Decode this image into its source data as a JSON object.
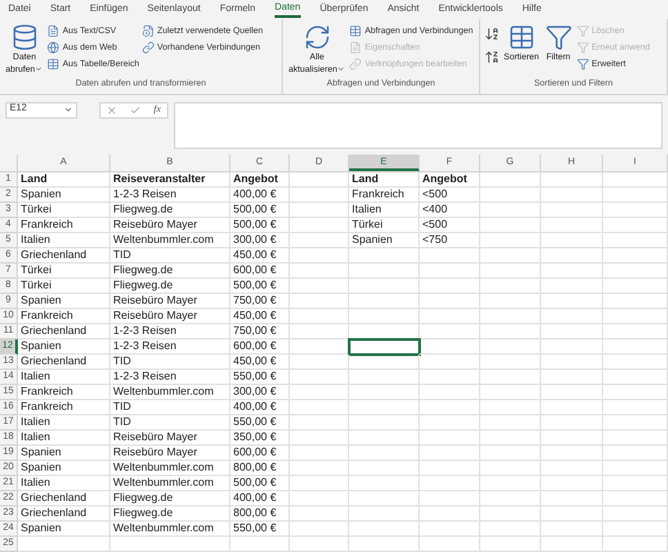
{
  "ribbon_tabs": [
    {
      "label": "Datei",
      "selected": false
    },
    {
      "label": "Start",
      "selected": false
    },
    {
      "label": "Einfügen",
      "selected": false
    },
    {
      "label": "Seitenlayout",
      "selected": false
    },
    {
      "label": "Formeln",
      "selected": false
    },
    {
      "label": "Daten",
      "selected": true
    },
    {
      "label": "Überprüfen",
      "selected": false
    },
    {
      "label": "Ansicht",
      "selected": false
    },
    {
      "label": "Entwicklertools",
      "selected": false
    },
    {
      "label": "Hilfe",
      "selected": false
    }
  ],
  "ribbon_groups": [
    {
      "label": "Daten abrufen und transformieren",
      "large": [
        {
          "lines": [
            "Daten",
            "abrufen"
          ],
          "dropdown": true
        }
      ],
      "columns": [
        [
          {
            "label": "Aus Text/CSV",
            "disabled": false
          },
          {
            "label": "Aus dem Web",
            "disabled": false
          },
          {
            "label": "Aus Tabelle/Bereich",
            "disabled": false
          }
        ],
        [
          {
            "label": "Zuletzt verwendete Quellen",
            "disabled": false
          },
          {
            "label": "Vorhandene Verbindungen",
            "disabled": false
          }
        ]
      ]
    },
    {
      "label": "Abfragen und Verbindungen",
      "large": [
        {
          "lines": [
            "Alle",
            "aktualisieren"
          ],
          "dropdown": true
        }
      ],
      "columns": [
        [
          {
            "label": "Abfragen und Verbindungen",
            "disabled": false
          },
          {
            "label": "Eigenschaften",
            "disabled": true
          },
          {
            "label": "Verknüpfungen bearbeiten",
            "disabled": true
          }
        ]
      ]
    },
    {
      "label": "Sortieren und Filtern",
      "large": [
        {
          "lines": [
            "Sortieren"
          ],
          "dropdown": false
        },
        {
          "lines": [
            "Filtern"
          ],
          "dropdown": false
        }
      ],
      "columns": [
        [
          {
            "label": "Löschen",
            "disabled": true
          },
          {
            "label": "Erneut anwend",
            "disabled": true
          },
          {
            "label": "Erweitert",
            "disabled": false
          }
        ]
      ]
    }
  ],
  "name_box": "E12",
  "formula_symbol": "fx",
  "columns": [
    {
      "letter": "A",
      "selected": false
    },
    {
      "letter": "B",
      "selected": false
    },
    {
      "letter": "C",
      "selected": false
    },
    {
      "letter": "D",
      "selected": false
    },
    {
      "letter": "E",
      "selected": true
    },
    {
      "letter": "F",
      "selected": false
    },
    {
      "letter": "G",
      "selected": false
    },
    {
      "letter": "H",
      "selected": false
    },
    {
      "letter": "I",
      "selected": false
    }
  ],
  "rows": [
    {
      "number": "1",
      "kind": "header",
      "selected": false,
      "main": [
        "Land",
        "Reiseveranstalter",
        "Angebot"
      ],
      "side": [
        "Land",
        "Angebot"
      ]
    },
    {
      "number": "2",
      "kind": "data",
      "selected": false,
      "main": [
        "Spanien",
        "1-2-3 Reisen",
        "400,00 €"
      ],
      "side": [
        "Frankreich",
        "<500"
      ]
    },
    {
      "number": "3",
      "kind": "data",
      "selected": false,
      "main": [
        "Türkei",
        "Fliegweg.de",
        "500,00 €"
      ],
      "side": [
        "Italien",
        "<400"
      ]
    },
    {
      "number": "4",
      "kind": "data",
      "selected": false,
      "main": [
        "Frankreich",
        "Reisebüro Mayer",
        "500,00 €"
      ],
      "side": [
        "Türkei",
        "<500"
      ]
    },
    {
      "number": "5",
      "kind": "data",
      "selected": false,
      "main": [
        "Italien",
        "Weltenbummler.com",
        "300,00 €"
      ],
      "side": [
        "Spanien",
        "<750"
      ]
    },
    {
      "number": "6",
      "kind": "data",
      "selected": false,
      "main": [
        "Griechenland",
        "TID",
        "450,00 €"
      ]
    },
    {
      "number": "7",
      "kind": "data",
      "selected": false,
      "main": [
        "Türkei",
        "Fliegweg.de",
        "600,00 €"
      ]
    },
    {
      "number": "8",
      "kind": "data",
      "selected": false,
      "main": [
        "Türkei",
        "Fliegweg.de",
        "500,00 €"
      ]
    },
    {
      "number": "9",
      "kind": "data",
      "selected": false,
      "main": [
        "Spanien",
        "Reisebüro Mayer",
        "750,00 €"
      ]
    },
    {
      "number": "10",
      "kind": "data",
      "selected": false,
      "main": [
        "Frankreich",
        "Reisebüro Mayer",
        "450,00 €"
      ]
    },
    {
      "number": "11",
      "kind": "data",
      "selected": false,
      "main": [
        "Griechenland",
        "1-2-3 Reisen",
        "750,00 €"
      ]
    },
    {
      "number": "12",
      "kind": "data",
      "selected": true,
      "main": [
        "Spanien",
        "1-2-3 Reisen",
        "600,00 €"
      ]
    },
    {
      "number": "13",
      "kind": "data",
      "selected": false,
      "main": [
        "Griechenland",
        "TID",
        "450,00 €"
      ]
    },
    {
      "number": "14",
      "kind": "data",
      "selected": false,
      "main": [
        "Italien",
        "1-2-3 Reisen",
        "550,00 €"
      ]
    },
    {
      "number": "15",
      "kind": "data",
      "selected": false,
      "main": [
        "Frankreich",
        "Weltenbummler.com",
        "300,00 €"
      ]
    },
    {
      "number": "16",
      "kind": "data",
      "selected": false,
      "main": [
        "Frankreich",
        "TID",
        "400,00 €"
      ]
    },
    {
      "number": "17",
      "kind": "data",
      "selected": false,
      "main": [
        "Italien",
        "TID",
        "550,00 €"
      ]
    },
    {
      "number": "18",
      "kind": "data",
      "selected": false,
      "main": [
        "Italien",
        "Reisebüro Mayer",
        "350,00 €"
      ]
    },
    {
      "number": "19",
      "kind": "data",
      "selected": false,
      "main": [
        "Spanien",
        "Reisebüro Mayer",
        "600,00 €"
      ]
    },
    {
      "number": "20",
      "kind": "data",
      "selected": false,
      "main": [
        "Spanien",
        "Weltenbummler.com",
        "800,00 €"
      ]
    },
    {
      "number": "21",
      "kind": "data",
      "selected": false,
      "main": [
        "Italien",
        "Weltenbummler.com",
        "500,00 €"
      ]
    },
    {
      "number": "22",
      "kind": "data",
      "selected": false,
      "main": [
        "Griechenland",
        "Fliegweg.de",
        "400,00 €"
      ]
    },
    {
      "number": "23",
      "kind": "data",
      "selected": false,
      "main": [
        "Griechenland",
        "Fliegweg.de",
        "800,00 €"
      ]
    },
    {
      "number": "24",
      "kind": "data",
      "selected": false,
      "main": [
        "Spanien",
        "Weltenbummler.com",
        "550,00 €"
      ]
    },
    {
      "number": "25",
      "kind": "data",
      "selected": false,
      "main": []
    }
  ]
}
